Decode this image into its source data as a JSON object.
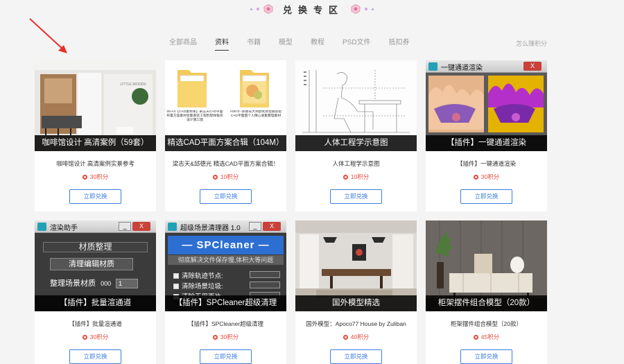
{
  "header": {
    "zone_title": "兑换专区"
  },
  "nav": {
    "tabs": [
      {
        "label": "全部商品",
        "active": false
      },
      {
        "label": "资料",
        "active": true
      },
      {
        "label": "书籍",
        "active": false
      },
      {
        "label": "模型",
        "active": false
      },
      {
        "label": "教程",
        "active": false
      },
      {
        "label": "PSD文件",
        "active": false
      },
      {
        "label": "抵扣券",
        "active": false
      }
    ],
    "how_to_earn": "怎么赚积分"
  },
  "cards": [
    {
      "caption": "咖啡馆设计 高清案例（59套）",
      "desc": "咖啡馆设计 高清案例实景参考",
      "points": "30积分",
      "button": "立即兑换",
      "thumb": "cafe",
      "sign_text": "LITTLE WOODS"
    },
    {
      "caption": "精选CAD平面方案合辑（104M）",
      "desc": "梁志天&邱德光 精选CAD平面方案合辑！",
      "points": "10积分",
      "button": "立即兑换",
      "thumb": "folders",
      "folder_label_1": "09-A4【CAD素材库】梁志天CAD平面布置方案素材合集家装工程别墅样板房设计施工图",
      "folder_label_2": "A0572--邱德光大师欧式新古典别墅CAD平面图个人精心收集整理素材"
    },
    {
      "caption": "人体工程学示意图",
      "desc": "人体工程学示意图",
      "points": "10积分",
      "button": "立即兑换",
      "thumb": "ergonomics"
    },
    {
      "caption": "【插件】一键通道渲染",
      "desc": "【插件】一键通道渲染",
      "points": "30积分",
      "button": "立即兑换",
      "thumb": "channel",
      "window_title": "一键通道渲染",
      "close_label": "X"
    },
    {
      "caption": "【插件】批量渲通道",
      "desc": "【插件】批量渲通道",
      "points": "30积分",
      "button": "立即兑换",
      "thumb": "render",
      "window_title": "渲染助手",
      "min_label": "_",
      "close_label": "X",
      "panel_head": "材质整理",
      "panel_btn_1": "清理编辑材质",
      "panel_row_label": "整理场景材质",
      "panel_row_value": "000",
      "panel_spin_value": "1"
    },
    {
      "caption": "【插件】SPCleaner超级清理",
      "desc": "【插件】SPCleaner超级清理",
      "points": "30积分",
      "button": "立即兑换",
      "thumb": "spc",
      "window_title": "超级场景清理器 1.0",
      "min_label": "_",
      "close_label": "X",
      "head": "— SPCleaner —",
      "sub": "彻底解决文件保存慢,体积大等问题",
      "opts": [
        "清除轨迹节点:",
        "清除场景垃圾:",
        "清除无用面片:"
      ]
    },
    {
      "caption": "国外模型精选",
      "desc": "国外模型：Apoco77 House by Zuliban",
      "points": "40积分",
      "button": "立即兑换",
      "thumb": "interior"
    },
    {
      "caption": "柜架摆件组合模型（20款）",
      "desc": "柜架摆件组合模型（20款）",
      "points": "45积分",
      "button": "立即兑换",
      "thumb": "cabinet"
    }
  ],
  "colors": {
    "accent": "#3b7ee0",
    "points": "#e84a3b",
    "caption_bg": "#000000"
  }
}
